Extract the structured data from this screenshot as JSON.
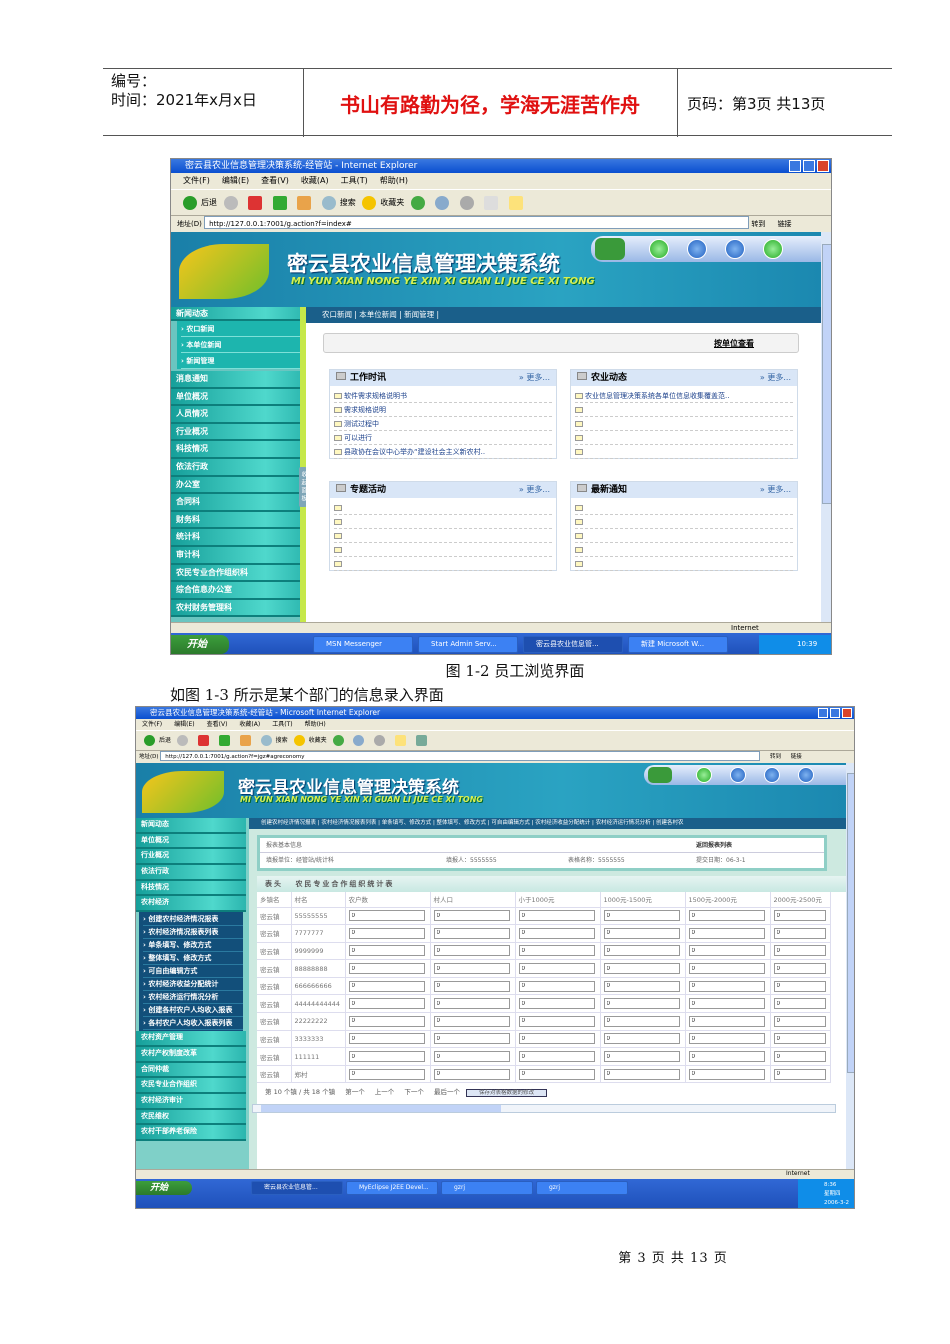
{
  "header": {
    "number_label": "编号：",
    "time_label": "时间：2021年x月x日",
    "motto": "书山有路勤为径，学海无涯苦作舟",
    "page_label": "页码：第3页  共13页"
  },
  "shot1": {
    "title": "密云县农业信息管理决策系统-经管站 - Internet Explorer",
    "menu": [
      "文件(F)",
      "编辑(E)",
      "查看(V)",
      "收藏(A)",
      "工具(T)",
      "帮助(H)"
    ],
    "toolbar": {
      "back": "后退",
      "search": "搜索",
      "favorites": "收藏夹"
    },
    "address_label": "地址(D)",
    "address": "http://127.0.0.1:7001/g.action?f=index#",
    "go": "转到",
    "links": "链接",
    "app_title": "密云县农业信息管理决策系统",
    "app_pinyin": "MI YUN XIAN NONG YE XIN XI GUAN LI JUE CE XI TONG",
    "sidebar_head": "新闻动态",
    "sidebar_sub": [
      "农口新闻",
      "本单位新闻",
      "新闻管理"
    ],
    "sidebar": [
      "消息通知",
      "单位概况",
      "人员情况",
      "行业概况",
      "科技情况",
      "依法行政",
      "办公室",
      "合同科",
      "财务科",
      "统计科",
      "审计科",
      "农民专业合作组织科",
      "综合信息办公室",
      "农村财务管理科"
    ],
    "collapse_label": "收起面板",
    "nav": "农口新闻 | 本单位新闻 | 新闻管理 |",
    "view_by_unit": "按单位查看",
    "more": "» 更多...",
    "panels": [
      {
        "title": "工作时讯",
        "items": [
          "软件需求规格说明书",
          "需求规格说明",
          "测试过程中",
          "可以进行",
          "县政协在会议中心举办“建设社会主义新农村.."
        ]
      },
      {
        "title": "农业动态",
        "items": [
          "农业信息管理决策系统各单位信息收集覆盖范..",
          "",
          "",
          "",
          ""
        ]
      },
      {
        "title": "专题活动",
        "items": [
          "",
          "",
          "",
          "",
          ""
        ]
      },
      {
        "title": "最新通知",
        "items": [
          "",
          "",
          "",
          "",
          ""
        ]
      }
    ],
    "status": "Internet",
    "taskbar": {
      "start": "开始",
      "items": [
        "MSN Messenger",
        "Start Admin Serv...",
        "密云县农业信息管...",
        "新建 Microsoft W..."
      ],
      "clock": "10:39"
    }
  },
  "caption1": "图 1-2 员工浏览界面",
  "intro2": "如图 1-3 所示是某个部门的信息录入界面",
  "shot2": {
    "title": "密云县农业信息管理决策系统-经管站 - Microsoft Internet Explorer",
    "menu": [
      "文件(F)",
      "编辑(E)",
      "查看(V)",
      "收藏(A)",
      "工具(T)",
      "帮助(H)"
    ],
    "toolbar": {
      "back": "后退",
      "search": "搜索",
      "favorites": "收藏夹"
    },
    "address_label": "地址(D)",
    "address": "http://127.0.0.1:7001/g.action?f=jgz#agreconomy",
    "go": "转到",
    "links": "链接",
    "app_title": "密云县农业信息管理决策系统",
    "app_pinyin": "MI YUN XIAN NONG YE XIN XI GUAN LI JUE CE XI TONG",
    "sidebar_top": [
      "新闻动态",
      "单位概况",
      "行业概况",
      "依法行政",
      "科技情况",
      "农村经济"
    ],
    "sidebar_sub": [
      "创建农村经济情况报表",
      "农村经济情况报表列表",
      "单条填写、修改方式",
      "整体填写、修改方式",
      "可自由编辑方式",
      "农村经济收益分配统计",
      "农村经济运行情况分析",
      "创建各村农户人均收入报表",
      "各村农户人均收入报表列表"
    ],
    "sidebar_bottom": [
      "农村资产管理",
      "农村产权制度改革",
      "合同仲裁",
      "农民专业合作组织",
      "农村经济审计",
      "农民维权",
      "农村干部养老保险"
    ],
    "nav": "创建农村经济情况报表 | 农村经济情况报表列表 | 单条填写、修改方式 | 整体填写、修改方式 | 可自由编辑方式 | 农村经济收益分配统计 | 农村经济运行情况分析 | 创建各村农",
    "info": {
      "title": "报表基本信息",
      "return": "返回报表列表",
      "unit": "填报单位：经管站/统计科",
      "person": "填报人：5555555",
      "form": "表格名称：5555555",
      "date": "提交日期：06-3-1"
    },
    "table_head_label": "表头",
    "table_title": "农民专业合作组织统计表",
    "columns": [
      "乡镇名",
      "村名",
      "农户数",
      "村人口",
      "小于1000元",
      "1000元-1500元",
      "1500元-2000元",
      "2000元-2500元"
    ],
    "rows": [
      [
        "密云镇",
        "55555555"
      ],
      [
        "密云镇",
        "7777777"
      ],
      [
        "密云镇",
        "9999999"
      ],
      [
        "密云镇",
        "88888888"
      ],
      [
        "密云镇",
        "666666666"
      ],
      [
        "密云镇",
        "44444444444"
      ],
      [
        "密云镇",
        "22222222"
      ],
      [
        "密云镇",
        "3333333"
      ],
      [
        "密云镇",
        "111111"
      ],
      [
        "密云镇",
        "郑村"
      ]
    ],
    "cell_value": "0",
    "pager": {
      "text": "第 10 个镇 / 共 18 个镇",
      "first": "第一个",
      "prev": "上一个",
      "next": "下一个",
      "last": "最后一个",
      "save": "保存对表格数据的修改"
    },
    "status": "Internet",
    "taskbar": {
      "start": "开始",
      "items": [
        "密云县农业信息管...",
        "MyEclipse J2EE Devel...",
        "gzrj",
        "gzrj"
      ],
      "clock": "8:36",
      "weekday": "星期四",
      "date": "2006-3-2"
    }
  },
  "footer": "第 3 页 共 13 页",
  "colors": {
    "motto": "#e01010",
    "banner": "#2aa3c2",
    "sidebar": "#1db5ae",
    "nav": "#1a5f8a",
    "titlebar": "#0a4fd0"
  }
}
